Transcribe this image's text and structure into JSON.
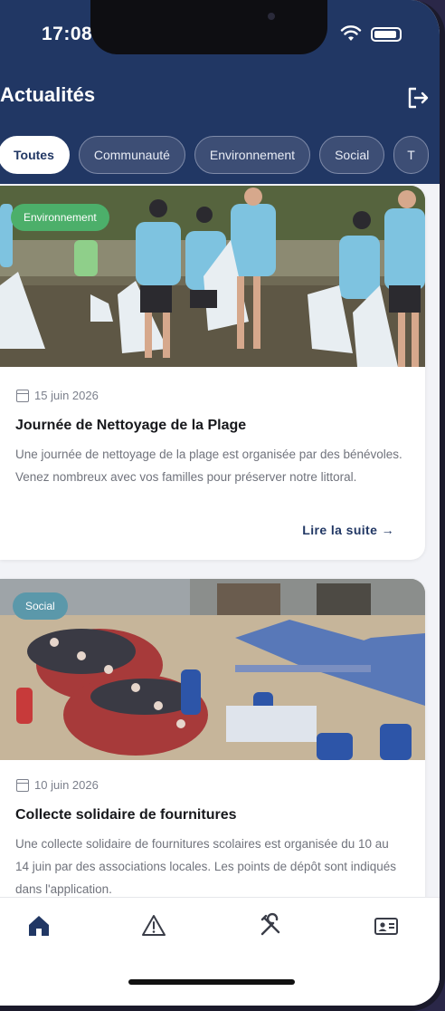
{
  "status_bar": {
    "time": "17:08"
  },
  "header": {
    "title": "Actualités"
  },
  "filters": [
    {
      "label": "Toutes",
      "active": true
    },
    {
      "label": "Communauté",
      "active": false
    },
    {
      "label": "Environnement",
      "active": false
    },
    {
      "label": "Social",
      "active": false
    }
  ],
  "news": [
    {
      "category": "Environnement",
      "date": "15 juin 2026",
      "title": "Journée de Nettoyage de la Plage",
      "text": "Une journée de nettoyage de la plage est organisée par des bénévoles. Venez nombreux avec vos familles pour préserver notre littoral.",
      "read_more": "Lire la suite →"
    },
    {
      "category": "Social",
      "date": "10 juin 2026",
      "title": "Collecte solidaire de fournitures",
      "text": "Une collecte solidaire de fournitures scolaires est organisée du 10 au 14 juin par des associations locales. Les points de dépôt sont indiqués dans l'application."
    }
  ],
  "tabbar": [
    {
      "icon": "home-icon",
      "active": true
    },
    {
      "icon": "warning-icon",
      "active": false
    },
    {
      "icon": "tools-icon",
      "active": false
    },
    {
      "icon": "id-card-icon",
      "active": false
    }
  ],
  "colors": {
    "primary": "#213764",
    "env_badge": "#4caf6a",
    "social_badge": "#5b98aa"
  }
}
